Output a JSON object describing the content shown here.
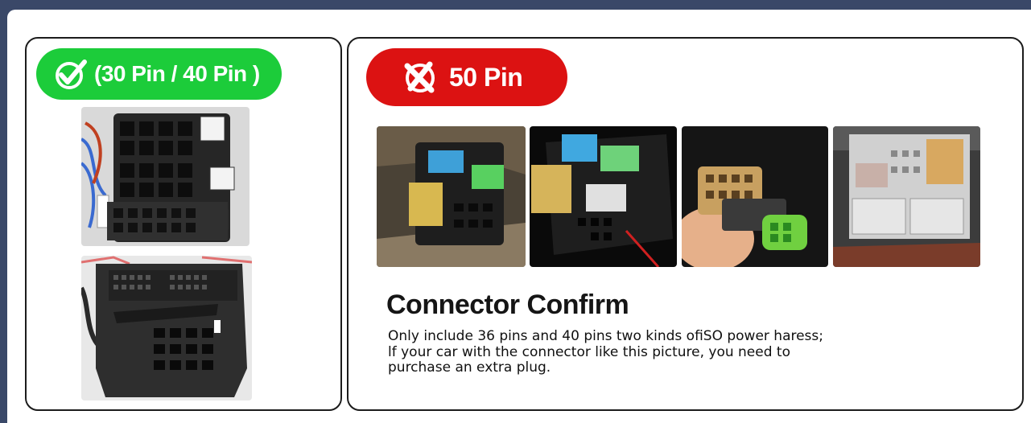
{
  "compatible": {
    "badge_text": "(30 Pin / 40 Pin )",
    "badge_color": "#1ccc3a",
    "badge_icon": "check-icon",
    "images": [
      {
        "name": "iso-connector-36pin-photo"
      },
      {
        "name": "quadlock-connector-40pin-photo"
      }
    ]
  },
  "incompatible": {
    "badge_text": "50 Pin",
    "badge_color": "#dc1212",
    "badge_icon": "cross-icon",
    "images": [
      {
        "name": "connector-photo-1"
      },
      {
        "name": "connector-photo-2"
      },
      {
        "name": "connector-photo-3"
      },
      {
        "name": "connector-photo-4"
      }
    ]
  },
  "confirm": {
    "title": "Connector Confirm",
    "lines": [
      "Only include 36 pins and 40 pins two kinds ofiSO power haress;",
      "lf your car with the connector like this picture, you need to",
      "purchase an extra plug."
    ]
  }
}
